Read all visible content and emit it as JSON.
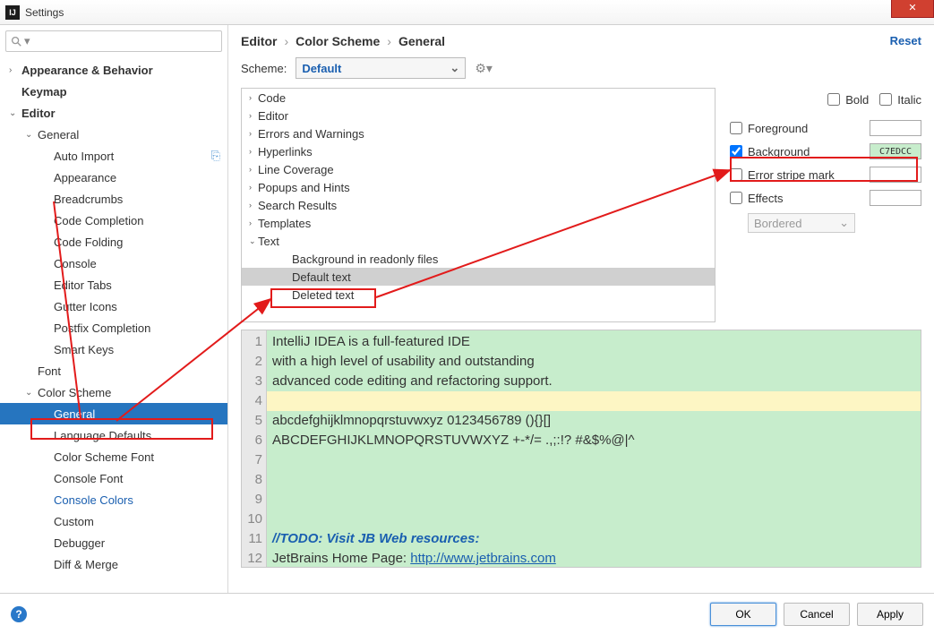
{
  "window": {
    "title": "Settings"
  },
  "search": {
    "placeholder": ""
  },
  "sidebar": {
    "items": [
      {
        "label": "Appearance & Behavior",
        "arrow": "›",
        "bold": true,
        "indent": 0
      },
      {
        "label": "Keymap",
        "arrow": "",
        "bold": true,
        "indent": 0
      },
      {
        "label": "Editor",
        "arrow": "⌄",
        "bold": true,
        "indent": 0
      },
      {
        "label": "General",
        "arrow": "⌄",
        "indent": 1
      },
      {
        "label": "Auto Import",
        "indent": 2,
        "badge": "⎘"
      },
      {
        "label": "Appearance",
        "indent": 2
      },
      {
        "label": "Breadcrumbs",
        "indent": 2
      },
      {
        "label": "Code Completion",
        "indent": 2
      },
      {
        "label": "Code Folding",
        "indent": 2
      },
      {
        "label": "Console",
        "indent": 2
      },
      {
        "label": "Editor Tabs",
        "indent": 2
      },
      {
        "label": "Gutter Icons",
        "indent": 2
      },
      {
        "label": "Postfix Completion",
        "indent": 2
      },
      {
        "label": "Smart Keys",
        "indent": 2
      },
      {
        "label": "Font",
        "indent": 1
      },
      {
        "label": "Color Scheme",
        "arrow": "⌄",
        "indent": 1
      },
      {
        "label": "General",
        "indent": 2,
        "selected": true
      },
      {
        "label": "Language Defaults",
        "indent": 2
      },
      {
        "label": "Color Scheme Font",
        "indent": 2
      },
      {
        "label": "Console Font",
        "indent": 2
      },
      {
        "label": "Console Colors",
        "indent": 2,
        "link": true
      },
      {
        "label": "Custom",
        "indent": 2
      },
      {
        "label": "Debugger",
        "indent": 2
      },
      {
        "label": "Diff & Merge",
        "indent": 2
      }
    ]
  },
  "breadcrumb": {
    "a": "Editor",
    "b": "Color Scheme",
    "c": "General"
  },
  "reset_label": "Reset",
  "scheme": {
    "label": "Scheme:",
    "value": "Default"
  },
  "attrtree": {
    "items": [
      {
        "label": "Code",
        "arrow": "›"
      },
      {
        "label": "Editor",
        "arrow": "›"
      },
      {
        "label": "Errors and Warnings",
        "arrow": "›"
      },
      {
        "label": "Hyperlinks",
        "arrow": "›"
      },
      {
        "label": "Line Coverage",
        "arrow": "›"
      },
      {
        "label": "Popups and Hints",
        "arrow": "›"
      },
      {
        "label": "Search Results",
        "arrow": "›"
      },
      {
        "label": "Templates",
        "arrow": "›"
      },
      {
        "label": "Text",
        "arrow": "⌄"
      },
      {
        "label": "Background in readonly files",
        "sub": true
      },
      {
        "label": "Default text",
        "sub": true,
        "sel": true
      },
      {
        "label": "Deleted text",
        "sub": true
      }
    ]
  },
  "props": {
    "bold": "Bold",
    "italic": "Italic",
    "foreground": "Foreground",
    "background": "Background",
    "errorstripe": "Error stripe mark",
    "effects": "Effects",
    "bg_hex": "C7EDCC",
    "effects_mode": "Bordered"
  },
  "preview": {
    "lines": [
      "IntelliJ IDEA is a full-featured IDE",
      "with a high level of usability and outstanding",
      "advanced code editing and refactoring support.",
      "",
      "abcdefghijklmnopqrstuvwxyz 0123456789 (){}[]",
      "ABCDEFGHIJKLMNOPQRSTUVWXYZ +-*/= .,;:!? #&$%@|^",
      "",
      "",
      "",
      "",
      "//TODO: Visit JB Web resources:",
      "JetBrains Home Page: http://www.jetbrains.com"
    ],
    "link": "http://www.jetbrains.com"
  },
  "buttons": {
    "ok": "OK",
    "cancel": "Cancel",
    "apply": "Apply"
  }
}
